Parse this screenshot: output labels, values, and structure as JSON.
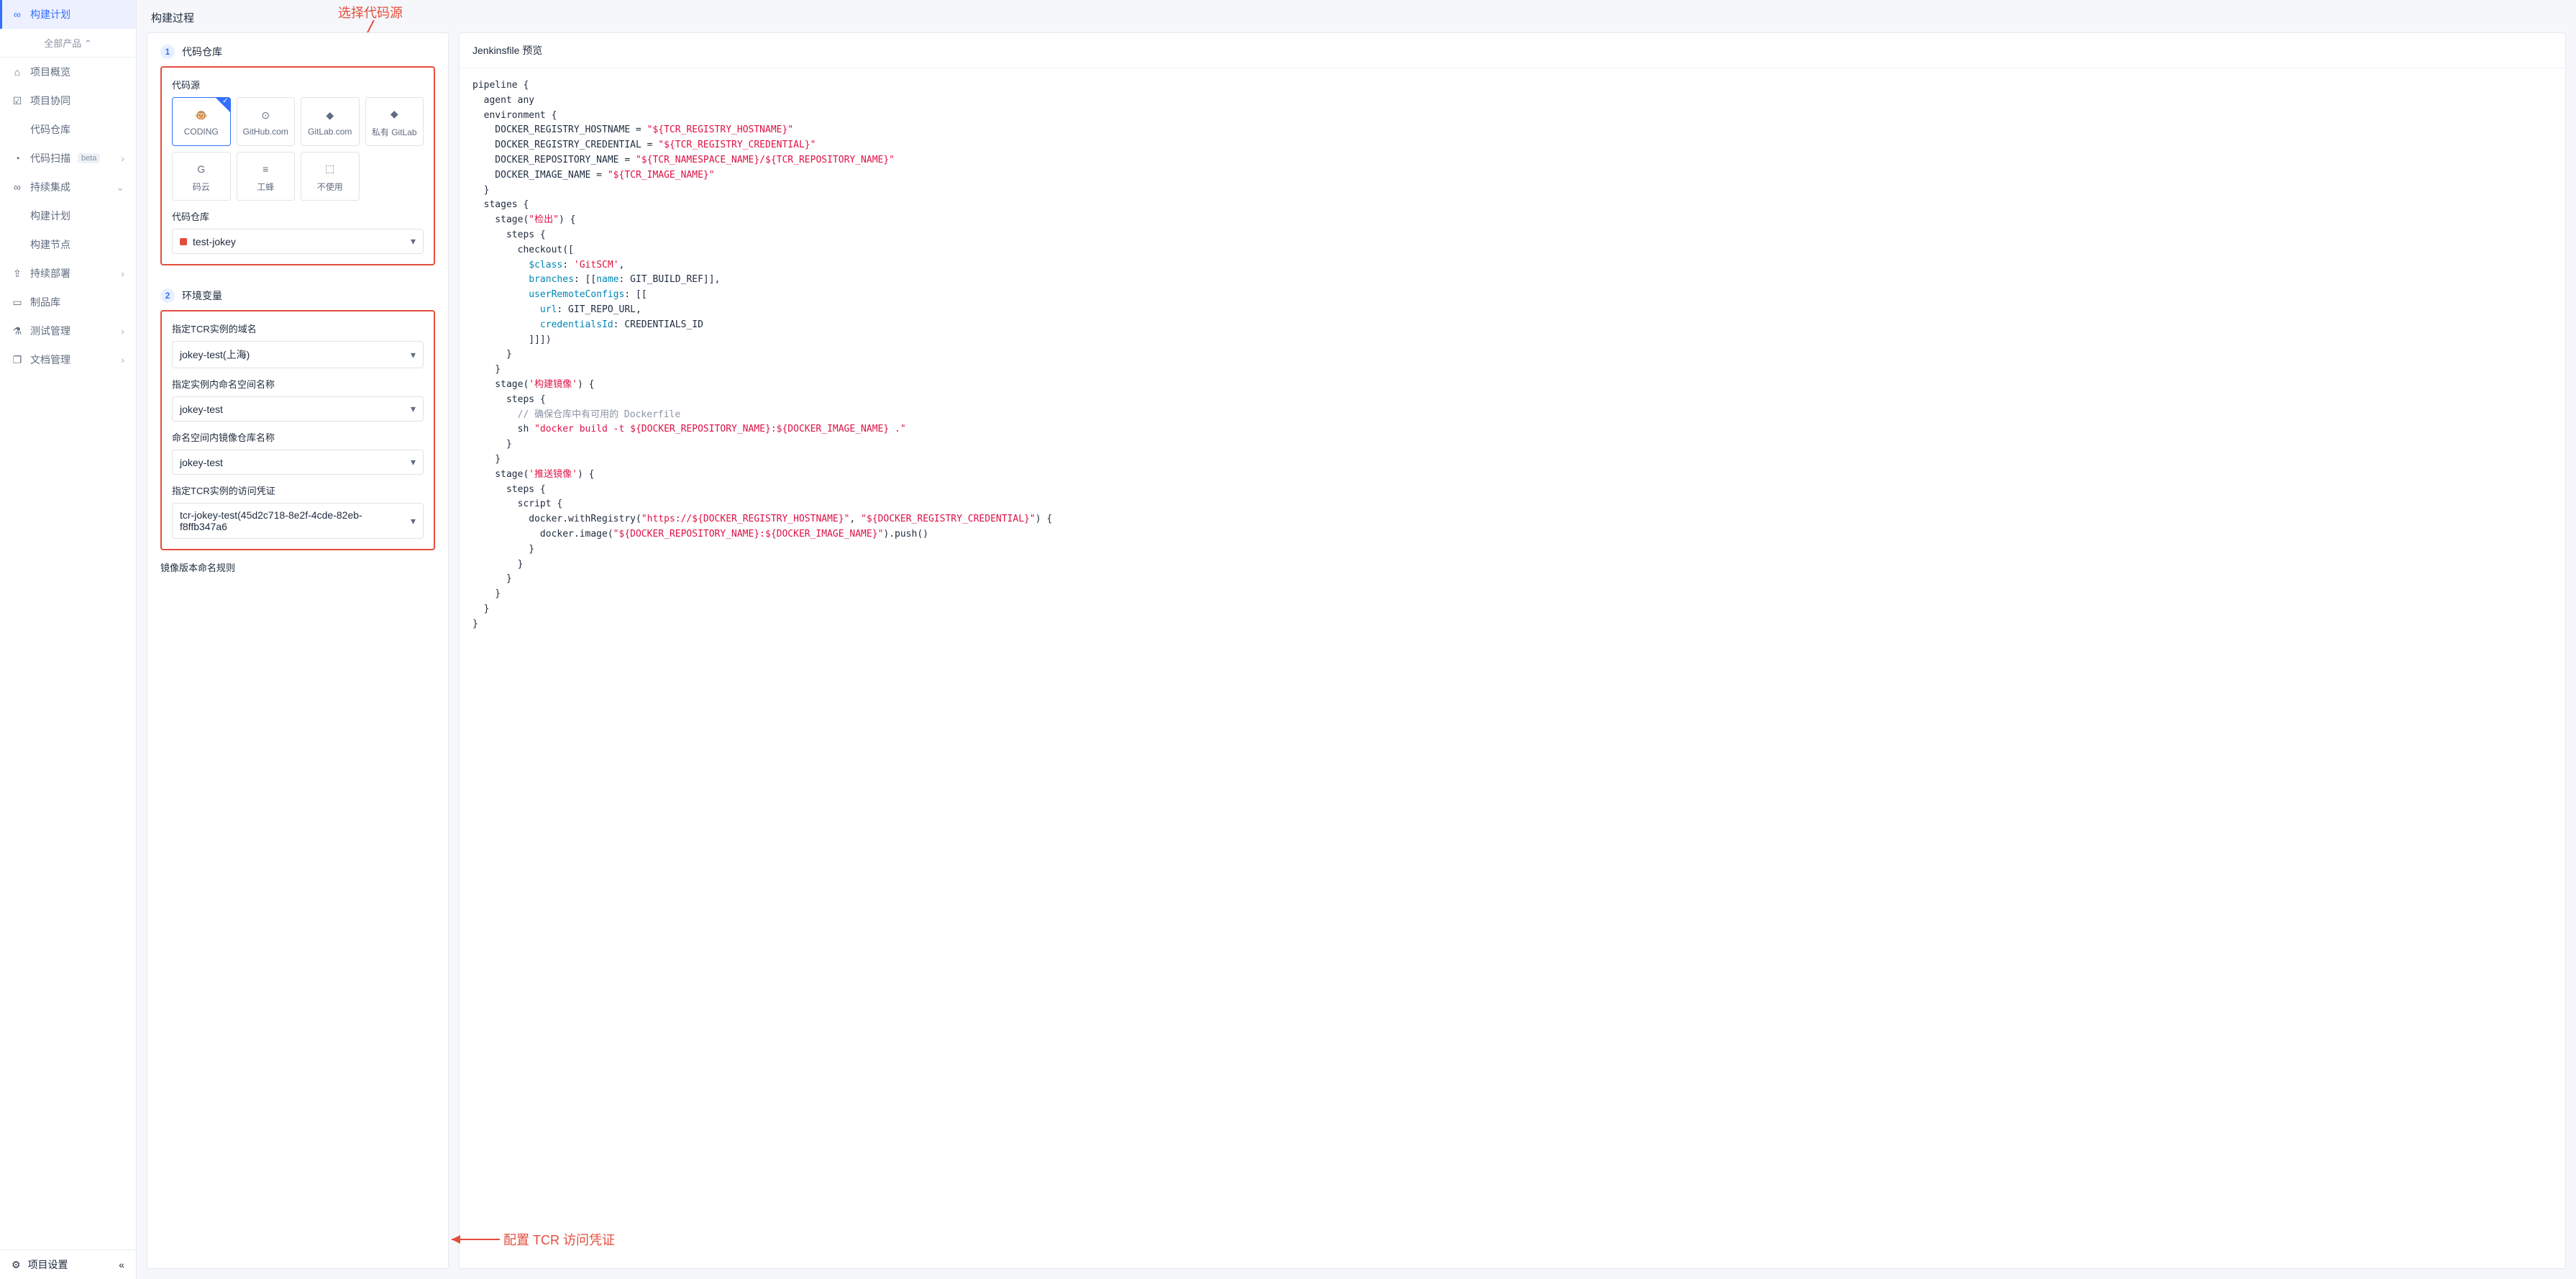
{
  "sidebar": {
    "topActive": "构建计划",
    "all": "全部产品",
    "items": [
      {
        "icon": "home",
        "label": "项目概览"
      },
      {
        "icon": "check",
        "label": "项目协同"
      },
      {
        "icon": "code",
        "label": "代码仓库"
      },
      {
        "icon": "scan",
        "label": "代码扫描",
        "badge": "beta",
        "chev": "›"
      },
      {
        "icon": "ci",
        "label": "持续集成",
        "chev": "⌄",
        "expanded": true,
        "subs": [
          "构建计划",
          "构建节点"
        ]
      },
      {
        "icon": "deploy",
        "label": "持续部署",
        "chev": "›"
      },
      {
        "icon": "artifact",
        "label": "制品库"
      },
      {
        "icon": "test",
        "label": "测试管理",
        "chev": "›"
      },
      {
        "icon": "doc",
        "label": "文档管理",
        "chev": "›"
      }
    ],
    "settings": "项目设置"
  },
  "header": {
    "title": "构建过程"
  },
  "annotations": {
    "topRed": "选择代码源",
    "bottomRed": "配置 TCR 访问凭证"
  },
  "steps": {
    "s1": {
      "num": "1",
      "title": "代码仓库",
      "sourceLabel": "代码源",
      "repoLabel": "代码仓库",
      "repoValue": "test-jokey",
      "sources": [
        {
          "name": "CODING",
          "selected": true
        },
        {
          "name": "GitHub.com"
        },
        {
          "name": "GitLab.com"
        },
        {
          "name": "私有 GitLab"
        },
        {
          "name": "码云"
        },
        {
          "name": "工蜂"
        },
        {
          "name": "不使用"
        }
      ]
    },
    "s2": {
      "num": "2",
      "title": "环境变量",
      "fields": [
        {
          "label": "指定TCR实例的域名",
          "value": "jokey-test(上海)"
        },
        {
          "label": "指定实例内命名空间名称",
          "value": "jokey-test"
        },
        {
          "label": "命名空间内镜像仓库名称",
          "value": "jokey-test"
        },
        {
          "label": "指定TCR实例的访问凭证",
          "value": "tcr-jokey-test(45d2c718-8e2f-4cde-82eb-f8ffb347a6"
        }
      ],
      "extra": "镜像版本命名规则"
    }
  },
  "preview": {
    "title": "Jenkinsfile 预览",
    "lines": [
      [
        {
          "t": "pipeline {"
        }
      ],
      [
        {
          "t": "  agent any"
        }
      ],
      [
        {
          "t": "  environment {"
        }
      ],
      [
        {
          "t": "    DOCKER_REGISTRY_HOSTNAME = "
        },
        {
          "c": "str",
          "t": "\"${TCR_REGISTRY_HOSTNAME}\""
        }
      ],
      [
        {
          "t": "    DOCKER_REGISTRY_CREDENTIAL = "
        },
        {
          "c": "str",
          "t": "\"${TCR_REGISTRY_CREDENTIAL}\""
        }
      ],
      [
        {
          "t": "    DOCKER_REPOSITORY_NAME = "
        },
        {
          "c": "str",
          "t": "\"${TCR_NAMESPACE_NAME}/${TCR_REPOSITORY_NAME}\""
        }
      ],
      [
        {
          "t": "    DOCKER_IMAGE_NAME = "
        },
        {
          "c": "str",
          "t": "\"${TCR_IMAGE_NAME}\""
        }
      ],
      [
        {
          "t": "  }"
        }
      ],
      [
        {
          "t": "  stages {"
        }
      ],
      [
        {
          "t": "    stage("
        },
        {
          "c": "str",
          "t": "\"检出\""
        },
        {
          "t": ") {"
        }
      ],
      [
        {
          "t": "      steps {"
        }
      ],
      [
        {
          "t": "        checkout(["
        }
      ],
      [
        {
          "t": "          "
        },
        {
          "c": "prop",
          "t": "$class"
        },
        {
          "t": ": "
        },
        {
          "c": "str",
          "t": "'GitSCM'"
        },
        {
          "t": ","
        }
      ],
      [
        {
          "t": "          "
        },
        {
          "c": "prop",
          "t": "branches"
        },
        {
          "t": ": [["
        },
        {
          "c": "prop",
          "t": "name"
        },
        {
          "t": ": GIT_BUILD_REF]],"
        }
      ],
      [
        {
          "t": "          "
        },
        {
          "c": "prop",
          "t": "userRemoteConfigs"
        },
        {
          "t": ": [["
        }
      ],
      [
        {
          "t": "            "
        },
        {
          "c": "prop",
          "t": "url"
        },
        {
          "t": ": GIT_REPO_URL,"
        }
      ],
      [
        {
          "t": "            "
        },
        {
          "c": "prop",
          "t": "credentialsId"
        },
        {
          "t": ": CREDENTIALS_ID"
        }
      ],
      [
        {
          "t": "          ]]])"
        }
      ],
      [
        {
          "t": "      }"
        }
      ],
      [
        {
          "t": "    }"
        }
      ],
      [
        {
          "t": "    stage("
        },
        {
          "c": "str",
          "t": "'构建镜像'"
        },
        {
          "t": ") {"
        }
      ],
      [
        {
          "t": "      steps {"
        }
      ],
      [
        {
          "t": "        "
        },
        {
          "c": "cmt",
          "t": "// 确保仓库中有可用的 Dockerfile"
        }
      ],
      [
        {
          "t": "        sh "
        },
        {
          "c": "str",
          "t": "\"docker build -t ${DOCKER_REPOSITORY_NAME}:${DOCKER_IMAGE_NAME} .\""
        }
      ],
      [
        {
          "t": "      }"
        }
      ],
      [
        {
          "t": "    }"
        }
      ],
      [
        {
          "t": "    stage("
        },
        {
          "c": "str",
          "t": "'推送镜像'"
        },
        {
          "t": ") {"
        }
      ],
      [
        {
          "t": "      steps {"
        }
      ],
      [
        {
          "t": "        script {"
        }
      ],
      [
        {
          "t": "          docker.withRegistry("
        },
        {
          "c": "str",
          "t": "\"https://${DOCKER_REGISTRY_HOSTNAME}\""
        },
        {
          "t": ", "
        },
        {
          "c": "str",
          "t": "\"${DOCKER_REGISTRY_CREDENTIAL}\""
        },
        {
          "t": ") {"
        }
      ],
      [
        {
          "t": "            docker.image("
        },
        {
          "c": "str",
          "t": "\"${DOCKER_REPOSITORY_NAME}:${DOCKER_IMAGE_NAME}\""
        },
        {
          "t": ").push()"
        }
      ],
      [
        {
          "t": "          }"
        }
      ],
      [
        {
          "t": "        }"
        }
      ],
      [
        {
          "t": "      }"
        }
      ],
      [
        {
          "t": "    }"
        }
      ],
      [
        {
          "t": "  }"
        }
      ],
      [
        {
          "t": "}"
        }
      ]
    ]
  }
}
